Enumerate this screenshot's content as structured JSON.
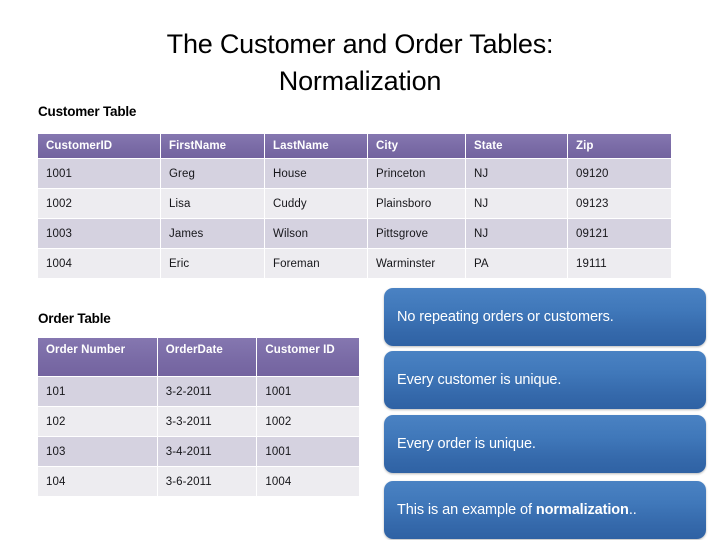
{
  "slide": {
    "title_line1": "The Customer and Order Tables:",
    "title_line2": "Normalization",
    "customer_table_label": "Customer Table",
    "order_table_label": "Order Table"
  },
  "colors": {
    "table_header": "#7a6ba6",
    "row_odd": "#d5d2e0",
    "row_even": "#edecf0",
    "callout_blue": "#3d74b4",
    "text": "#000000",
    "callout_text": "#ffffff"
  },
  "customer_table": {
    "columns": [
      "CustomerID",
      "FirstName",
      "LastName",
      "City",
      "State",
      "Zip"
    ],
    "rows": [
      [
        "1001",
        "Greg",
        "House",
        "Princeton",
        "NJ",
        "09120"
      ],
      [
        "1002",
        "Lisa",
        "Cuddy",
        "Plainsboro",
        "NJ",
        "09123"
      ],
      [
        "1003",
        "James",
        "Wilson",
        "Pittsgrove",
        "NJ",
        "09121"
      ],
      [
        "1004",
        "Eric",
        "Foreman",
        "Warminster",
        "PA",
        "19111"
      ]
    ]
  },
  "order_table": {
    "columns": [
      "Order Number",
      "OrderDate",
      "Customer ID"
    ],
    "rows": [
      [
        "101",
        "3-2-2011",
        "1001"
      ],
      [
        "102",
        "3-3-2011",
        "1002"
      ],
      [
        "103",
        "3-4-2011",
        "1001"
      ],
      [
        "104",
        "3-6-2011",
        "1004"
      ]
    ]
  },
  "callouts": [
    {
      "text": "No repeating orders or customers.",
      "bold_word": ""
    },
    {
      "text": "Every customer is unique.",
      "bold_word": ""
    },
    {
      "text": "Every order is unique.",
      "bold_word": ""
    },
    {
      "text_prefix": "This is an example of ",
      "bold_word": "normalization",
      "text_suffix": ".."
    }
  ]
}
